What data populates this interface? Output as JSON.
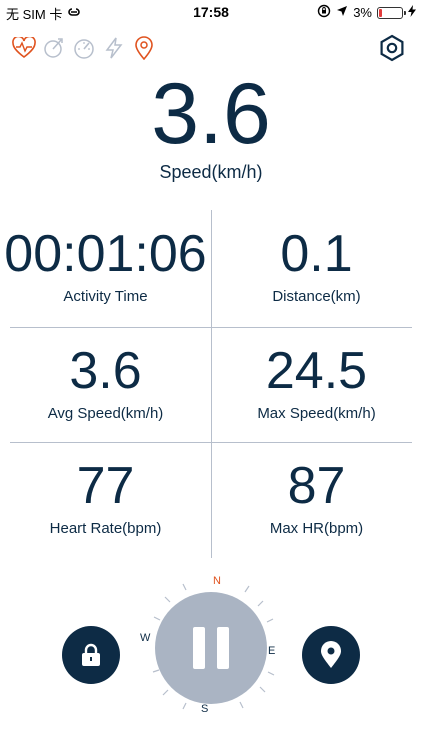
{
  "status_bar": {
    "carrier": "无 SIM 卡",
    "time": "17:58",
    "battery_percent": "3%",
    "battery_level": 0.03,
    "battery_color": "#e23b3b"
  },
  "top_icons": [
    "heart-rate-icon",
    "speed-sensor-icon",
    "speedometer-icon",
    "power-icon",
    "location-pin-icon"
  ],
  "speed": {
    "value": "3.6",
    "label": "Speed(km/h)"
  },
  "metrics": [
    {
      "value": "00:01:06",
      "label": "Activity Time"
    },
    {
      "value": "0.1",
      "label": "Distance(km)"
    },
    {
      "value": "3.6",
      "label": "Avg Speed(km/h)"
    },
    {
      "value": "24.5",
      "label": "Max Speed(km/h)"
    },
    {
      "value": "77",
      "label": "Heart Rate(bpm)"
    },
    {
      "value": "87",
      "label": "Max HR(bpm)"
    }
  ],
  "compass": {
    "n": "N",
    "e": "E",
    "s": "S",
    "w": "W"
  },
  "colors": {
    "primary": "#0d2b45",
    "accent": "#e0531f",
    "pause_bg": "#aab4c3",
    "divider": "#b7bfcc"
  }
}
